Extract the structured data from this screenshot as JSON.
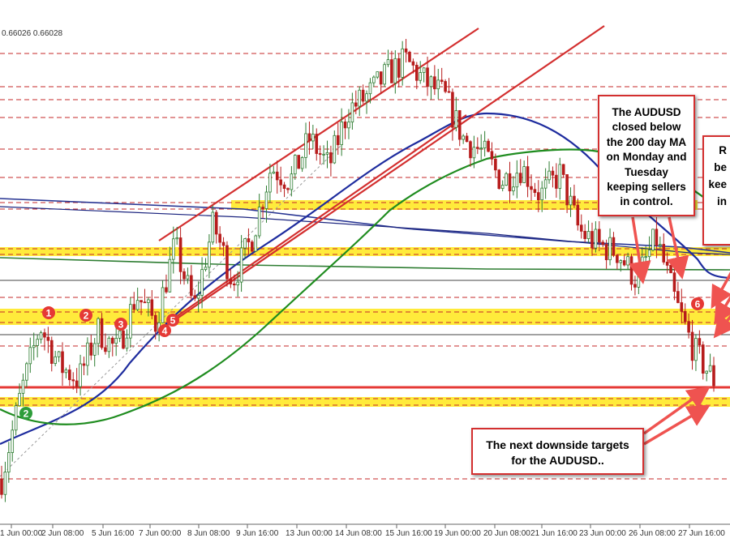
{
  "header": {
    "price_readout": "0.66026 0.66028"
  },
  "chart_data": {
    "type": "candlestick",
    "symbol": "AUDUSD",
    "x_tick_labels": [
      "1 Jun 00:00",
      "2 Jun 08:00",
      "5 Jun 16:00",
      "7 Jun 00:00",
      "8 Jun 08:00",
      "9 Jun 16:00",
      "13 Jun 00:00",
      "14 Jun 08:00",
      "15 Jun 16:00",
      "19 Jun 00:00",
      "20 Jun 08:00",
      "21 Jun 16:00",
      "23 Jun 00:00",
      "26 Jun 08:00",
      "27 Jun 16:00"
    ],
    "price_path": [
      [
        0,
        0.658
      ],
      [
        2,
        0.664
      ],
      [
        3,
        0.6688
      ],
      [
        4,
        0.666
      ],
      [
        5,
        0.665
      ],
      [
        6,
        0.6685
      ],
      [
        7,
        0.667
      ],
      [
        8,
        0.671
      ],
      [
        9,
        0.669
      ],
      [
        10,
        0.6745
      ],
      [
        11,
        0.67
      ],
      [
        12,
        0.676
      ],
      [
        13,
        0.672
      ],
      [
        14,
        0.675
      ],
      [
        15,
        0.68
      ],
      [
        16,
        0.679
      ],
      [
        17,
        0.682
      ],
      [
        18,
        0.68
      ],
      [
        19,
        0.684
      ],
      [
        20,
        0.685
      ],
      [
        21,
        0.6865
      ],
      [
        22,
        0.6875
      ],
      [
        23,
        0.686
      ],
      [
        24,
        0.685
      ],
      [
        25,
        0.682
      ],
      [
        26,
        0.681
      ],
      [
        27,
        0.679
      ],
      [
        28,
        0.68
      ],
      [
        29,
        0.678
      ],
      [
        30,
        0.6795
      ],
      [
        31,
        0.6755
      ],
      [
        32,
        0.6745
      ],
      [
        33,
        0.674
      ],
      [
        34,
        0.672
      ],
      [
        35,
        0.675
      ],
      [
        36,
        0.6705
      ],
      [
        37,
        0.667
      ],
      [
        38,
        0.665
      ]
    ],
    "series": [
      {
        "name": "100-hour MA",
        "color": "#1a237e"
      },
      {
        "name": "200-hour MA",
        "color": "#1b8c1b"
      }
    ],
    "markers": [
      {
        "label": "1",
        "color": "#e53935"
      },
      {
        "label": "2",
        "color": "#e53935"
      },
      {
        "label": "3",
        "color": "#e53935"
      },
      {
        "label": "4",
        "color": "#e53935"
      },
      {
        "label": "5",
        "color": "#e53935"
      },
      {
        "label": "6",
        "color": "#e53935"
      },
      {
        "label": "2",
        "color": "#2e9d3a"
      }
    ],
    "annotations": [
      {
        "text_lines": [
          "The AUDUSD",
          "closed below",
          "the 200 day MA",
          "on Monday and",
          "Tuesday",
          "keeping sellers",
          "in control."
        ]
      },
      {
        "text_lines": [
          "R",
          "be",
          "kee",
          "in"
        ]
      },
      {
        "text_lines": [
          "The next downside targets",
          "for the AUDUSD.."
        ]
      }
    ],
    "colors": {
      "support_zone": "#ffeb3b",
      "trend_lines": "#d32f2f",
      "arrows": "#ef5350"
    }
  }
}
